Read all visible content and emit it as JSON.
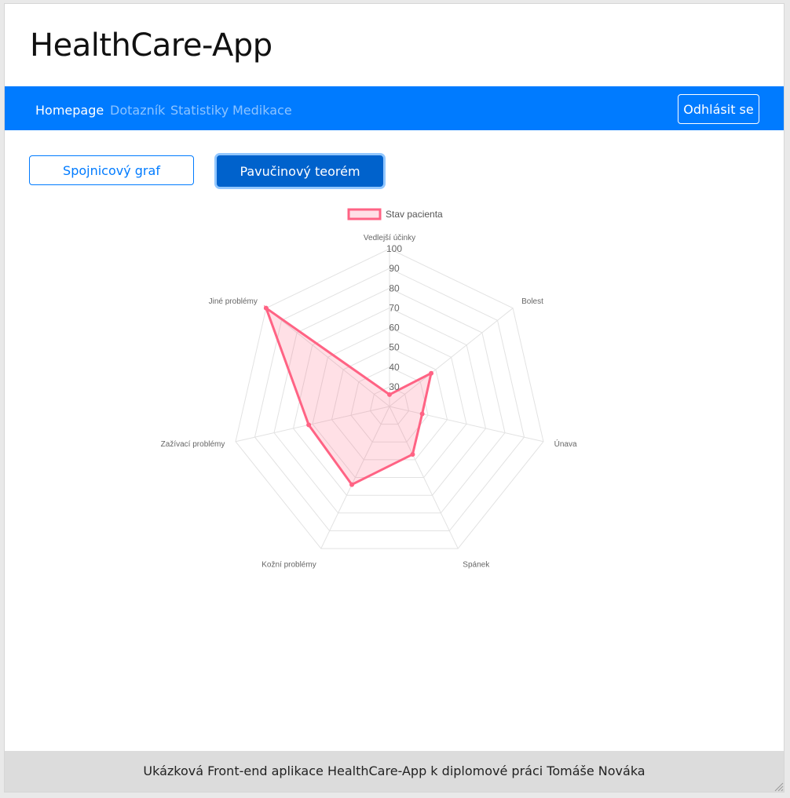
{
  "app": {
    "title": "HealthCare-App"
  },
  "nav": {
    "items": [
      {
        "label": "Homepage",
        "active": true
      },
      {
        "label": "Dotazník",
        "active": false
      },
      {
        "label": "Statistiky",
        "active": false
      },
      {
        "label": "Medikace",
        "active": false
      }
    ],
    "logout_label": "Odhlásit se"
  },
  "chart_toggle": {
    "line_label": "Spojnicový graf",
    "radar_label": "Pavučinový teorém"
  },
  "chart_data": {
    "type": "radar",
    "categories": [
      "Vedlejší účinky",
      "Bolest",
      "Únava",
      "Spánek",
      "Kožní problémy",
      "Zažívací problémy",
      "Jiné problémy"
    ],
    "series": [
      {
        "name": "Stav pacienta",
        "values": [
          26,
          47,
          37,
          47,
          64,
          62,
          100
        ],
        "color": "#ff6384",
        "fill": "rgba(255,99,132,0.2)"
      }
    ],
    "rlim": [
      20,
      100
    ],
    "ticks": [
      30,
      40,
      50,
      60,
      70,
      80,
      90,
      100
    ],
    "grid": true,
    "legend_position": "top"
  },
  "footer": {
    "text": "Ukázková Front-end aplikace HealthCare-App k diplomové práci Tomáše Nováka"
  }
}
